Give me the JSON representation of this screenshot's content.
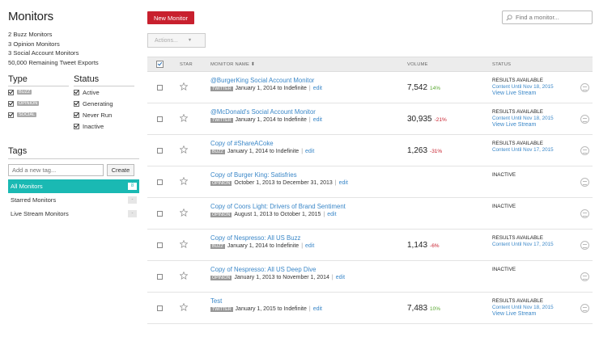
{
  "sidebar": {
    "title": "Monitors",
    "counts": [
      "2  Buzz Monitors",
      "3  Opinion Monitors",
      "3  Social Account Monitors",
      "50,000 Remaining Tweet Exports"
    ],
    "type": {
      "heading": "Type",
      "items": [
        {
          "label": "BUZZ",
          "checked": true
        },
        {
          "label": "OPINION",
          "checked": true
        },
        {
          "label": "SOCIAL",
          "checked": true
        }
      ]
    },
    "status": {
      "heading": "Status",
      "items": [
        {
          "label": "Active",
          "checked": true
        },
        {
          "label": "Generating",
          "checked": true
        },
        {
          "label": "Never Run",
          "checked": true
        },
        {
          "label": "Inactive",
          "checked": true
        }
      ]
    },
    "tags": {
      "heading": "Tags",
      "placeholder": "Add a new tag...",
      "create_label": "Create",
      "items": [
        {
          "label": "All Monitors",
          "count": "8",
          "active": true
        },
        {
          "label": "Starred Monitors",
          "count": "-",
          "active": false
        },
        {
          "label": "Live Stream Monitors",
          "count": "-",
          "active": false
        }
      ]
    }
  },
  "toolbar": {
    "new_monitor_label": "New Monitor",
    "search_placeholder": "Find a monitor...",
    "actions_label": "Actions...",
    "actions_caret": "▼"
  },
  "table": {
    "headers": {
      "star": "STAR",
      "name": "MONITOR NAME",
      "name_sort": "⬍",
      "volume": "VOLUME",
      "status": "STATUS"
    },
    "rows": [
      {
        "name": "@BurgerKing Social Account Monitor",
        "type": "TWITTER",
        "dates": "January 1, 2014 to Indefinite",
        "edit": "edit",
        "volume": "7,542",
        "change": "14%",
        "change_color": "#5aa832",
        "status": "RESULTS AVAILABLE",
        "status_sub": "Content Until Nov 18, 2015",
        "status_link": "View Live Stream"
      },
      {
        "name": "@McDonald's Social Account Monitor",
        "type": "TWITTER",
        "dates": "January 1, 2014 to Indefinite",
        "edit": "edit",
        "volume": "30,935",
        "change": "-21%",
        "change_color": "#c8202e",
        "status": "RESULTS AVAILABLE",
        "status_sub": "Content Until Nov 18, 2015",
        "status_link": "View Live Stream"
      },
      {
        "name": "Copy of #ShareACoke",
        "type": "BUZZ",
        "dates": "January 1, 2014 to Indefinite",
        "edit": "edit",
        "volume": "1,263",
        "change": "-31%",
        "change_color": "#c8202e",
        "status": "RESULTS AVAILABLE",
        "status_sub": "Content Until Nov 17, 2015",
        "status_link": ""
      },
      {
        "name": "Copy of Burger King: Satisfries",
        "type": "OPINION",
        "dates": "October 1, 2013 to December 31, 2013",
        "edit": "edit",
        "volume": "",
        "change": "",
        "change_color": "#333333",
        "status": "INACTIVE",
        "status_sub": "",
        "status_link": ""
      },
      {
        "name": "Copy of Coors Light: Drivers of Brand Sentiment",
        "type": "OPINION",
        "dates": "August 1, 2013 to October 1, 2015",
        "edit": "edit",
        "volume": "",
        "change": "",
        "change_color": "#333333",
        "status": "INACTIVE",
        "status_sub": "",
        "status_link": ""
      },
      {
        "name": "Copy of Nespresso: All US Buzz",
        "type": "BUZZ",
        "dates": "January 1, 2014 to Indefinite",
        "edit": "edit",
        "volume": "1,143",
        "change": "-6%",
        "change_color": "#c8202e",
        "status": "RESULTS AVAILABLE",
        "status_sub": "Content Until Nov 17, 2015",
        "status_link": ""
      },
      {
        "name": "Copy of Nespresso: All US Deep Dive",
        "type": "OPINION",
        "dates": "January 1, 2013 to November 1, 2014",
        "edit": "edit",
        "volume": "",
        "change": "",
        "change_color": "#333333",
        "status": "INACTIVE",
        "status_sub": "",
        "status_link": ""
      },
      {
        "name": "Test",
        "type": "TWITTER",
        "dates": "January 1, 2015 to Indefinite",
        "edit": "edit",
        "volume": "7,483",
        "change": "10%",
        "change_color": "#5aa832",
        "status": "RESULTS AVAILABLE",
        "status_sub": "Content Until Nov 18, 2015",
        "status_link": "View Live Stream"
      }
    ]
  }
}
